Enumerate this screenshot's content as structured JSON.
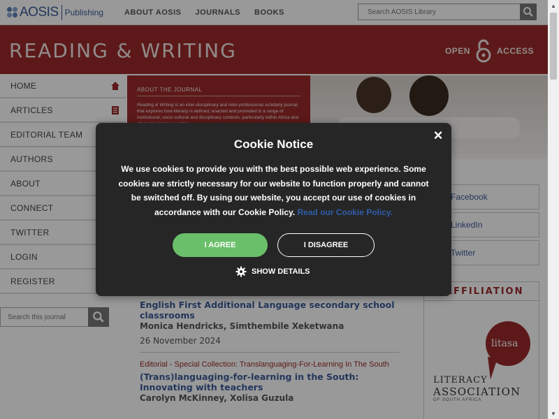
{
  "header": {
    "logo_text": "AOSIS",
    "logo_sub": "Publishing",
    "nav": [
      "ABOUT AOSIS",
      "JOURNALS",
      "BOOKS"
    ],
    "search_placeholder": "Search AOSIS Library"
  },
  "banner": {
    "title": "READING & WRITING",
    "open_access_left": "OPEN",
    "open_access_right": "ACCESS"
  },
  "sidebar": {
    "items": [
      "HOME",
      "ARTICLES",
      "EDITORIAL TEAM",
      "AUTHORS",
      "ABOUT",
      "CONNECT",
      "TWITTER",
      "LOGIN",
      "REGISTER"
    ],
    "search_placeholder": "Search this journal"
  },
  "about": {
    "heading": "ABOUT THE JOURNAL",
    "text": "Reading & Writing is an inter-disciplinary and inter-professional scholarly journal that explores how literacy is defined, enacted and promoted in a range of institutional, socio-cultural and disciplinary contexts, particularly within Africa and other developing countries."
  },
  "social": [
    "Facebook",
    "LinkedIn",
    "Twitter"
  ],
  "affiliation": {
    "title": "AFFILIATION",
    "bubble": "litasa",
    "line1": "LITERACY",
    "line2": "ASSOCIATION",
    "line3": "OF SOUTH AFRICA"
  },
  "articles": [
    {
      "title": "English First Additional Language secondary school classrooms",
      "authors": "Monica Hendricks, Simthembile Xeketwana",
      "date": "26 November 2024"
    },
    {
      "category": "Editorial - Special Collection: Translanguaging-For-Learning In The South",
      "title": "(Trans)languaging-for-learning in the South: Innovating with teachers",
      "authors": "Carolyn McKinney, Xolisa Guzula"
    }
  ],
  "cookie": {
    "title": "Cookie Notice",
    "close": "×",
    "body": "We use cookies to provide you with the best possible web experience. Some cookies are strictly necessary for our website to function properly and cannot be switched off. By using our website, you accept our use of cookies in accordance with our Cookie Policy.",
    "link": "Read our Cookie Policy.",
    "agree": "I AGREE",
    "disagree": "I DISAGREE",
    "details": "SHOW DETAILS"
  },
  "colors": {
    "brand_red": "#9b2b2b",
    "brand_blue": "#3b5a98",
    "agree_green": "#6abf6a",
    "modal_bg": "#262626"
  }
}
